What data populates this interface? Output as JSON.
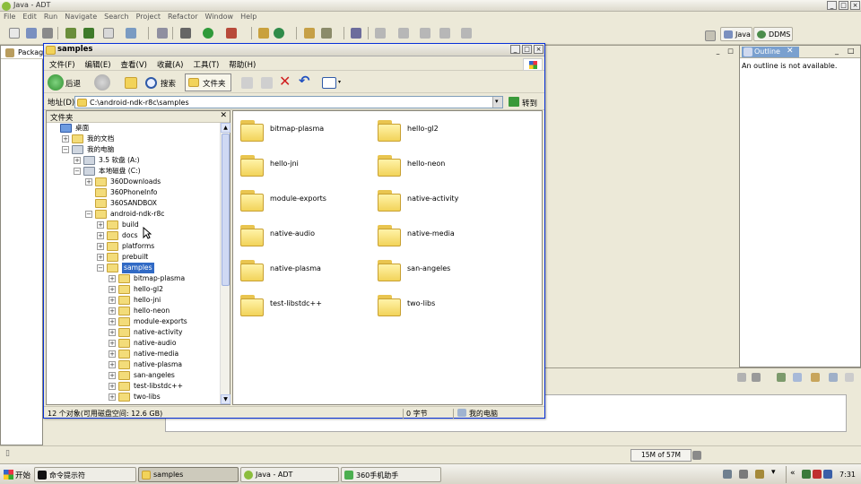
{
  "eclipse": {
    "title": "Java - ADT",
    "menu": [
      "File",
      "Edit",
      "Run",
      "Navigate",
      "Search",
      "Project",
      "Refactor",
      "Window",
      "Help"
    ],
    "perspectives": [
      "Java",
      "DDMS"
    ],
    "package_tab": "Package",
    "outline_tab": "Outline",
    "outline_message": "An outline is not available.",
    "heap_status": "15M of 57M"
  },
  "explorer": {
    "title": "samples",
    "menu": [
      "文件(F)",
      "编辑(E)",
      "查看(V)",
      "收藏(A)",
      "工具(T)",
      "帮助(H)"
    ],
    "toolbar": {
      "back": "后退",
      "search": "搜索",
      "folders": "文件夹"
    },
    "address_label": "地址(D)",
    "address_value": "C:\\android-ndk-r8c\\samples",
    "go_label": "转到",
    "folder_pane_title": "文件夹",
    "tree": [
      {
        "label": "桌面",
        "level": 0,
        "exp": ""
      },
      {
        "label": "我的文档",
        "level": 1,
        "exp": "+"
      },
      {
        "label": "我的电脑",
        "level": 1,
        "exp": "-"
      },
      {
        "label": "3.5 软盘 (A:)",
        "level": 2,
        "exp": "+"
      },
      {
        "label": "本地磁盘 (C:)",
        "level": 2,
        "exp": "-"
      },
      {
        "label": "360Downloads",
        "level": 3,
        "exp": "+"
      },
      {
        "label": "360PhoneInfo",
        "level": 3,
        "exp": ""
      },
      {
        "label": "360SANDBOX",
        "level": 3,
        "exp": ""
      },
      {
        "label": "android-ndk-r8c",
        "level": 3,
        "exp": "-"
      },
      {
        "label": "build",
        "level": 4,
        "exp": "+"
      },
      {
        "label": "docs",
        "level": 4,
        "exp": "+"
      },
      {
        "label": "platforms",
        "level": 4,
        "exp": "+"
      },
      {
        "label": "prebuilt",
        "level": 4,
        "exp": "+"
      },
      {
        "label": "samples",
        "level": 4,
        "exp": "-",
        "selected": true
      },
      {
        "label": "bitmap-plasma",
        "level": 5,
        "exp": "+"
      },
      {
        "label": "hello-gl2",
        "level": 5,
        "exp": "+"
      },
      {
        "label": "hello-jni",
        "level": 5,
        "exp": "+"
      },
      {
        "label": "hello-neon",
        "level": 5,
        "exp": "+"
      },
      {
        "label": "module-exports",
        "level": 5,
        "exp": "+"
      },
      {
        "label": "native-activity",
        "level": 5,
        "exp": "+"
      },
      {
        "label": "native-audio",
        "level": 5,
        "exp": "+"
      },
      {
        "label": "native-media",
        "level": 5,
        "exp": "+"
      },
      {
        "label": "native-plasma",
        "level": 5,
        "exp": "+"
      },
      {
        "label": "san-angeles",
        "level": 5,
        "exp": "+"
      },
      {
        "label": "test-libstdc++",
        "level": 5,
        "exp": "+"
      },
      {
        "label": "two-libs",
        "level": 5,
        "exp": "+"
      }
    ],
    "files": [
      "bitmap-plasma",
      "hello-gl2",
      "hello-jni",
      "hello-neon",
      "module-exports",
      "native-activity",
      "native-audio",
      "native-media",
      "native-plasma",
      "san-angeles",
      "test-libstdc++",
      "two-libs"
    ],
    "status": {
      "objects": "12 个对象(可用磁盘空间: 12.6 GB)",
      "size": "0 字节",
      "location": "我的电脑"
    }
  },
  "taskbar": {
    "start": "开始",
    "tasks": [
      "命令提示符",
      "samples",
      "Java - ADT",
      "360手机助手"
    ],
    "clock": "7:31"
  },
  "colors": {
    "selection": "#316ac5",
    "folder": "#f2d35a",
    "xp_blue": "#0831d9"
  }
}
